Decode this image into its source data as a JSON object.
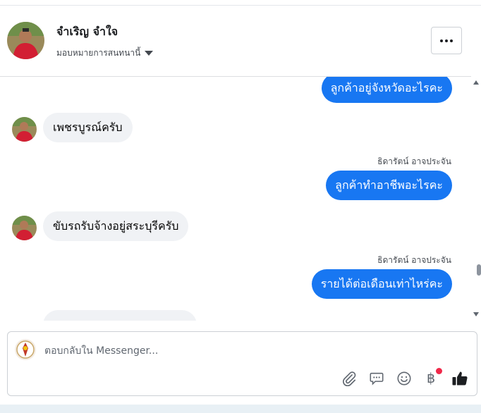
{
  "header": {
    "contact_name": "จำเริญ จำใจ",
    "assign_label": "มอบหมายการสนทนานี้"
  },
  "messages": [
    {
      "direction": "out",
      "text": "ลูกค้าอยู่จังหวัดอะไรคะ"
    },
    {
      "direction": "in",
      "text": "เพชรบูรณ์ครับ"
    },
    {
      "direction": "out",
      "sender": "ธิดารัตน์ อาจประจัน",
      "text": "ลูกค้าทำอาชีพอะไรคะ"
    },
    {
      "direction": "in",
      "text": "ขับรถรับจ้างอยู่สระบุรีครับ"
    },
    {
      "direction": "out",
      "sender": "ธิดารัตน์ อาจประจัน",
      "text": "รายได้ต่อเดือนเท่าไหร่คะ"
    }
  ],
  "composer": {
    "placeholder": "ตอบกลับใน Messenger..."
  },
  "icons": {
    "baht_glyph": "฿"
  },
  "colors": {
    "outgoing_bubble": "#1877f2",
    "incoming_bubble": "#f0f2f5",
    "notification_dot": "#f02849"
  }
}
